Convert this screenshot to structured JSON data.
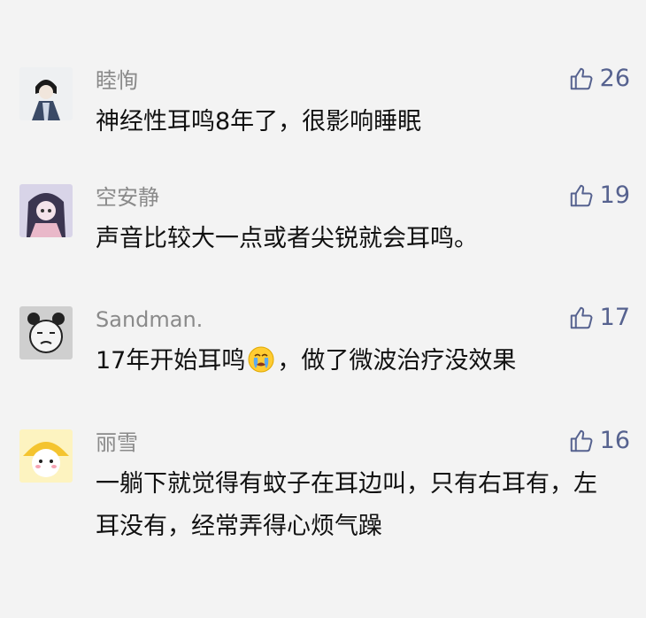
{
  "comments": [
    {
      "user": "睦恂",
      "likes": "26",
      "text": "神经性耳鸣8年了，很影响睡眠"
    },
    {
      "user": "空安静",
      "likes": "19",
      "text": "声音比较大一点或者尖锐就会耳鸣。"
    },
    {
      "user": "Sandman.",
      "likes": "17",
      "text_before": "17年开始耳鸣",
      "emoji": "crying-face-emoji",
      "text_after": "，做了微波治疗没效果"
    },
    {
      "user": "丽雪",
      "likes": "16",
      "text": "一躺下就觉得有蚊子在耳边叫，只有右耳有，左耳没有，经常弄得心烦气躁"
    }
  ],
  "colors": {
    "like": "#56628f",
    "username": "#8a8a8a",
    "background": "#f3f3f3"
  },
  "icons": {
    "like": "thumbs-up-outline-icon"
  }
}
